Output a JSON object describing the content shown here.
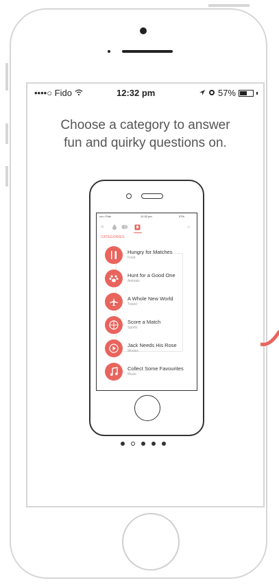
{
  "status_bar": {
    "carrier": "••••○ Fido",
    "time": "12:32 pm",
    "battery": "57%",
    "battery_level": 0.57
  },
  "headline": {
    "line1": "Choose a category to answer",
    "line2": "fun and quirky questions on."
  },
  "mini_status": {
    "carrier": "••••○ Fido",
    "time": "12:32 pm",
    "battery": "57%"
  },
  "mini_nav": {
    "menu": "≡",
    "search": "⌕"
  },
  "categories_label": "CATEGORIES",
  "categories": [
    {
      "title": "Hungry for Matches",
      "subtitle": "Food",
      "icon": "fork-knife-icon"
    },
    {
      "title": "Hunt for a Good One",
      "subtitle": "Animals",
      "icon": "paw-icon"
    },
    {
      "title": "A Whole New World",
      "subtitle": "Travel",
      "icon": "airplane-icon"
    },
    {
      "title": "Score a Match",
      "subtitle": "Sports",
      "icon": "basketball-icon"
    },
    {
      "title": "Jack Needs His Rose",
      "subtitle": "Movies",
      "icon": "play-icon"
    },
    {
      "title": "Collect Some Favourites",
      "subtitle": "Music",
      "icon": "music-note-icon"
    }
  ],
  "pagination": {
    "count": 5,
    "active_index": 1
  },
  "colors": {
    "accent": "#e8645d",
    "device_border": "#d6d6d6"
  }
}
